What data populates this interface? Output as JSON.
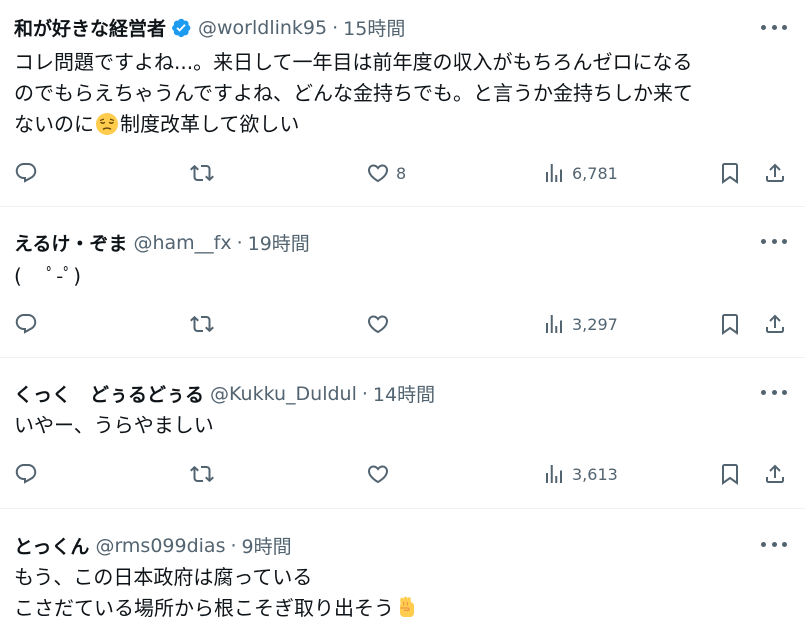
{
  "tweets": [
    {
      "name": "和が好きな経営者",
      "verified": true,
      "handle": "@worldlink95",
      "separator": "·",
      "time": "15時間",
      "text_lines": [
        "コレ問題ですよね...。来日して一年目は前年度の収入がもちろんゼロになる",
        "のでもらえちゃうんですよね、どんな金持ちでも。と言うか金持ちしか来て",
        "ないのに"
      ],
      "text_line3_tail": "制度改革して欲しい",
      "emoji_inline": "pensive-face",
      "replies": "",
      "retweets": "",
      "likes": "8",
      "views": "6,781"
    },
    {
      "name": "えるけ・ぞま",
      "handle": "@ham__fx",
      "separator": "·",
      "time": "19時間",
      "text_lines": [
        "(　 ﾟ-ﾟ)"
      ],
      "likes": "",
      "views": "3,297"
    },
    {
      "name": "くっく　どぅるどぅる",
      "handle": "@Kukku_Duldul",
      "separator": "·",
      "time": "14時間",
      "text_lines": [
        "いやー、うらやましい"
      ],
      "likes": "",
      "views": "3,613"
    },
    {
      "name": "とっくん",
      "handle": "@rms099dias",
      "separator": "·",
      "time": "9時間",
      "text_lines": [
        "もう、この日本政府は腐っている",
        "こさだている場所から根こそぎ取り出そう"
      ],
      "emoji_tail": "raised-fist"
    }
  ],
  "colors": {
    "text": "#0f1419",
    "secondary": "#536471",
    "verified": "#1d9bf0",
    "divider": "#eff3f4",
    "emoji": "#ffcc4d"
  }
}
